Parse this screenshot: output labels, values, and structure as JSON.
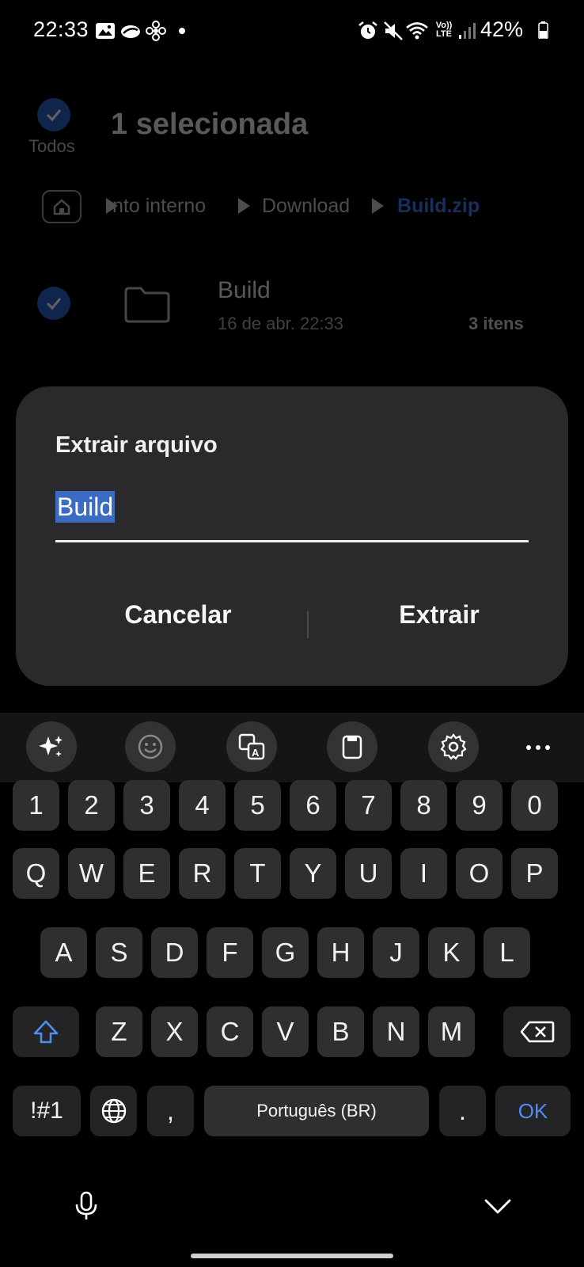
{
  "status_bar": {
    "time": "22:33",
    "battery_pct": "42%",
    "notification_icons": [
      "image-icon",
      "cloud-icon",
      "fan-icon",
      "dot-icon"
    ],
    "system_icons": [
      "alarm-icon",
      "mute-icon",
      "wifi-icon",
      "volte-icon",
      "signal-icon",
      "battery-icon"
    ],
    "volte_label": "Vo)) LTE"
  },
  "background": {
    "select_all_label": "Todos",
    "title": "1 selecionada",
    "breadcrumb": [
      "nto interno",
      "Download",
      "Build.zip"
    ],
    "file": {
      "name": "Build",
      "date": "16 de abr. 22:33",
      "count": "3 itens"
    }
  },
  "dialog": {
    "title": "Extrair arquivo",
    "input_value": "Build",
    "cancel_label": "Cancelar",
    "confirm_label": "Extrair"
  },
  "keyboard": {
    "toolbar": [
      "ai-sparkle-icon",
      "emoji-icon",
      "translate-icon",
      "clipboard-icon",
      "settings-icon",
      "more-icon"
    ],
    "row_numbers": [
      "1",
      "2",
      "3",
      "4",
      "5",
      "6",
      "7",
      "8",
      "9",
      "0"
    ],
    "row_top": [
      "Q",
      "W",
      "E",
      "R",
      "T",
      "Y",
      "U",
      "I",
      "O",
      "P"
    ],
    "row_middle": [
      "A",
      "S",
      "D",
      "F",
      "G",
      "H",
      "J",
      "K",
      "L"
    ],
    "row_bottom": [
      "Z",
      "X",
      "C",
      "V",
      "B",
      "N",
      "M"
    ],
    "symbols_label": "!#1",
    "comma_label": ",",
    "space_label": "Português (BR)",
    "period_label": ".",
    "ok_label": "OK"
  },
  "colors": {
    "accent": "#3f7cf0",
    "dialog_bg": "#2a2a2c",
    "key_bg": "#2f2f31",
    "selection": "#3a6cc4"
  }
}
